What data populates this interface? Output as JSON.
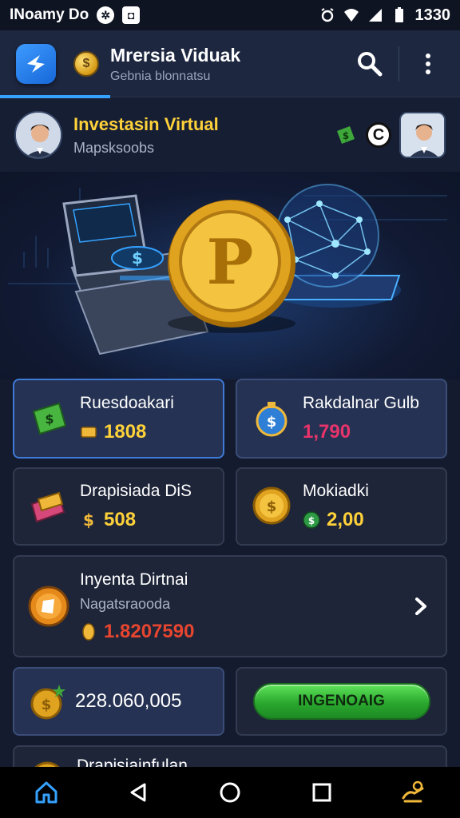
{
  "status_bar": {
    "left_text": "INoamy Do",
    "time": "1330"
  },
  "app_bar": {
    "title": "Mrersia Viduak",
    "subtitle": "Gebnia blonnatsu"
  },
  "profile": {
    "title": "Investasin Virtual",
    "subtitle": "Mapsksoobs"
  },
  "cards": [
    {
      "title": "Ruesdoakari",
      "value": "1808",
      "value_color": "#ffd23a"
    },
    {
      "title": "Rakdalnar Gulb",
      "value": "1,790",
      "value_color": "#e8336b"
    },
    {
      "title": "Drapisiada DiS",
      "value": "508",
      "value_color": "#ffd23a"
    },
    {
      "title": "Mokiadki",
      "value": "2,00",
      "value_color": "#ffd23a"
    }
  ],
  "wide_card": {
    "title": "Inyenta Dirtnai",
    "subtitle": "Nagatsraooda",
    "value": "1.8207590",
    "value_color": "#e8452f"
  },
  "balance_card": {
    "value": "228.060,005"
  },
  "cta": {
    "label": "INGENOAIG"
  },
  "partial_card": {
    "title": "Drapisiainfulan"
  },
  "colors": {
    "accent": "#35a2ff",
    "gold": "#ffd23a",
    "green": "#2aa82e"
  }
}
